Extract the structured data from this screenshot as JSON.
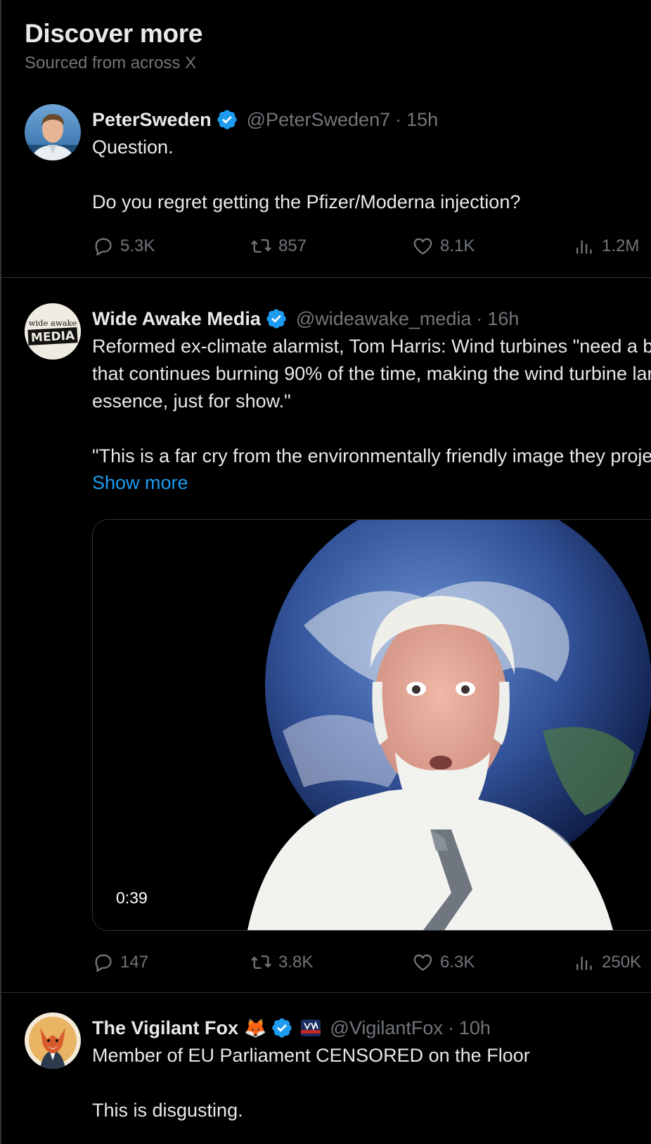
{
  "discover": {
    "title": "Discover more",
    "subtitle": "Sourced from across X"
  },
  "posts": [
    {
      "name": "PeterSweden",
      "handle": "@PeterSweden7",
      "separator": "·",
      "time": "15h",
      "text": "Question.\n\nDo you regret getting the Pfizer/Moderna injection?",
      "replies": "5.3K",
      "reposts": "857",
      "likes": "8.1K",
      "views": "1.2M"
    },
    {
      "name": "Wide Awake Media",
      "handle": "@wideawake_media",
      "separator": "·",
      "time": "16h",
      "avatar_text_top": "wide awake",
      "avatar_text_bottom": "MEDIA",
      "text": "Reformed ex-climate alarmist, Tom Harris: Wind turbines \"need a backup fossil fuel plant that continues burning 90% of the time, making the wind turbine largely unnecessary and, in essence, just for show.\"\n\n\"This is a far cry from the environmentally friendly image they project.\"",
      "show_more": "Show more",
      "video_duration": "0:39",
      "replies": "147",
      "reposts": "3.8K",
      "likes": "6.3K",
      "views": "250K"
    },
    {
      "name": "The Vigilant Fox",
      "emoji": "🦊",
      "handle": "@VigilantFox",
      "separator": "·",
      "time": "10h",
      "text": "Member of EU Parliament CENSORED on the Floor\n\nThis is disgusting."
    }
  ],
  "colors": {
    "background": "#000000",
    "text": "#e7e9ea",
    "secondary": "#71767b",
    "link": "#1d9bf0",
    "verified": "#1d9bf0",
    "divider": "#2f3336"
  },
  "icons": [
    "reply-icon",
    "repost-icon",
    "like-icon",
    "views-icon",
    "verified-badge-icon"
  ]
}
